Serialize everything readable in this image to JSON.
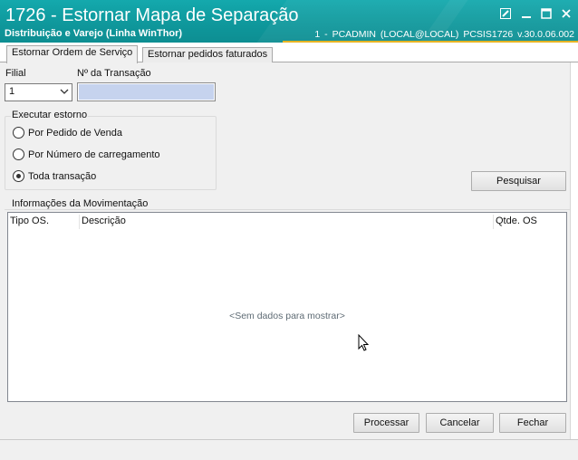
{
  "window": {
    "title": "1726 - Estornar Mapa de Separação",
    "subtitle": "Distribuição e Varejo (Linha WinThor)",
    "session_info": "1 - PCADMIN (LOCAL@LOCAL)   PCSIS1726  v.30.0.06.002"
  },
  "tabs": [
    {
      "label": "Estornar Ordem de Serviço",
      "active": true
    },
    {
      "label": "Estornar pedidos faturados",
      "active": false
    }
  ],
  "form": {
    "filial_label": "Filial",
    "filial_value": "1",
    "transacao_label": "Nº da Transação",
    "transacao_value": ""
  },
  "estorno": {
    "group_title": "Executar estorno",
    "options": [
      {
        "label": "Por Pedido de Venda",
        "checked": false
      },
      {
        "label": "Por Número de carregamento",
        "checked": false
      },
      {
        "label": "Toda transação",
        "checked": true
      }
    ]
  },
  "buttons": {
    "pesquisar": "Pesquisar",
    "processar": "Processar",
    "cancelar": "Cancelar",
    "fechar": "Fechar"
  },
  "movimentacao": {
    "group_title": "Informações da Movimentação",
    "columns": [
      "Tipo OS.",
      "Descrição",
      "Qtde. OS"
    ],
    "empty_text": "<Sem dados para mostrar>"
  },
  "colors": {
    "titlebar": "#0f989c",
    "accent_line": "#e6b424",
    "input_bg": "#c6d3ee"
  }
}
